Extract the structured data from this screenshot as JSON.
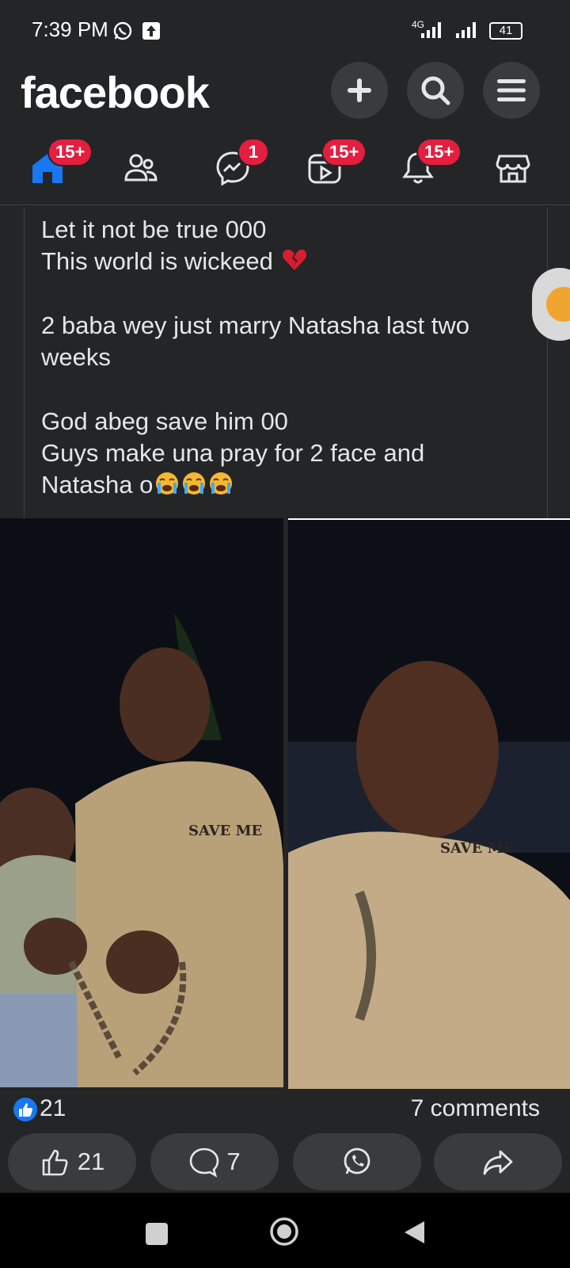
{
  "status_bar": {
    "time": "7:39 PM",
    "network": "4G",
    "battery": "41",
    "icons": [
      "whatsapp-icon",
      "upload-icon",
      "signal-icon",
      "battery-icon"
    ]
  },
  "header": {
    "logo": "facebook",
    "buttons": [
      "create-icon",
      "search-icon",
      "menu-icon"
    ]
  },
  "nav": {
    "items": [
      {
        "name": "home",
        "badge": "15+"
      },
      {
        "name": "friends",
        "badge": ""
      },
      {
        "name": "messenger",
        "badge": "1"
      },
      {
        "name": "video",
        "badge": "15+"
      },
      {
        "name": "notifications",
        "badge": "15+"
      },
      {
        "name": "marketplace",
        "badge": ""
      }
    ]
  },
  "post": {
    "lines": [
      "Let it not be true 000",
      "This world is wickeed",
      "",
      "2 baba  wey just marry Natasha last two",
      "weeks",
      "",
      "God abeg save him 00",
      "Guys make una pray for 2 face and",
      "Natasha o"
    ],
    "emojis": [
      "broken-heart",
      "loudly-crying",
      "loudly-crying",
      "loudly-crying"
    ],
    "photo_labels": [
      "SAVE ME",
      "SAVE ME"
    ]
  },
  "reactions": {
    "likes": "21",
    "comments": "7 comments"
  },
  "actions": {
    "like_count": "21",
    "comment_count": "7"
  },
  "colors": {
    "background": "#242527",
    "button": "#3a3b3c",
    "badge": "#e41e3f",
    "like_blue": "#1877f2"
  }
}
